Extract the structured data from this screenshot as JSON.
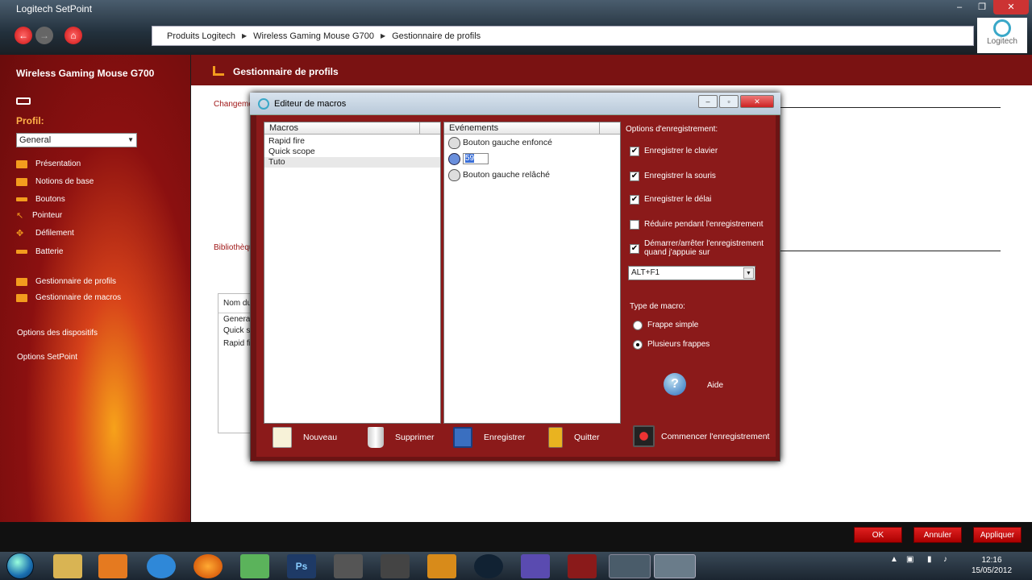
{
  "window": {
    "title": "Logitech SetPoint",
    "logo_text": "Logitech"
  },
  "breadcrumb": [
    "Produits Logitech",
    "Wireless Gaming Mouse G700",
    "Gestionnaire de profils"
  ],
  "sidebar": {
    "device_name": "Wireless Gaming Mouse G700",
    "profile_label": "Profil:",
    "profile_value": "General",
    "items": [
      {
        "label": "Présentation"
      },
      {
        "label": "Notions de base"
      },
      {
        "label": "Boutons"
      },
      {
        "label": "Pointeur"
      },
      {
        "label": "Défilement"
      },
      {
        "label": "Batterie"
      },
      {
        "label": "Gestionnaire de profils"
      },
      {
        "label": "Gestionnaire de macros"
      }
    ],
    "links": [
      "Options des dispositifs",
      "Options SetPoint"
    ]
  },
  "main": {
    "title": "Gestionnaire de profils",
    "section1": "Changeme",
    "section2": "Bibliothèqu",
    "table_header": "Nom du",
    "table_rows": [
      "General",
      "Quick sc",
      "Rapid fir"
    ]
  },
  "bottom_buttons": {
    "ok": "OK",
    "cancel": "Annuler",
    "apply": "Appliquer"
  },
  "dialog": {
    "title": "Editeur de macros",
    "macros_header": "Macros",
    "macros": [
      "Rapid fire",
      "Quick scope",
      "Tuto"
    ],
    "events_header": "Evénements",
    "events": {
      "press": "Bouton gauche enfoncé",
      "delay_value": "59",
      "release": "Bouton gauche relâché"
    },
    "options_title": "Options d'enregistrement:",
    "options": [
      {
        "label": "Enregistrer le clavier",
        "checked": true
      },
      {
        "label": "Enregistrer la souris",
        "checked": true
      },
      {
        "label": "Enregistrer le délai",
        "checked": true
      },
      {
        "label": "Réduire pendant l'enregistrement",
        "checked": false
      },
      {
        "label": "Démarrer/arrêter l'enregistrement quand j'appuie sur",
        "checked": true
      }
    ],
    "hotkey": "ALT+F1",
    "macro_type_label": "Type de macro:",
    "macro_types": [
      {
        "label": "Frappe simple",
        "selected": false
      },
      {
        "label": "Plusieurs frappes",
        "selected": true
      }
    ],
    "help_label": "Aide",
    "toolbar": {
      "new": "Nouveau",
      "delete": "Supprimer",
      "save": "Enregistrer",
      "quit": "Quitter",
      "record": "Commencer l'enregistrement"
    }
  },
  "taskbar": {
    "time": "12:16",
    "date": "15/05/2012"
  },
  "colors": {
    "accent_red": "#8b1a1a",
    "sidebar_orange": "#f39c1e"
  }
}
